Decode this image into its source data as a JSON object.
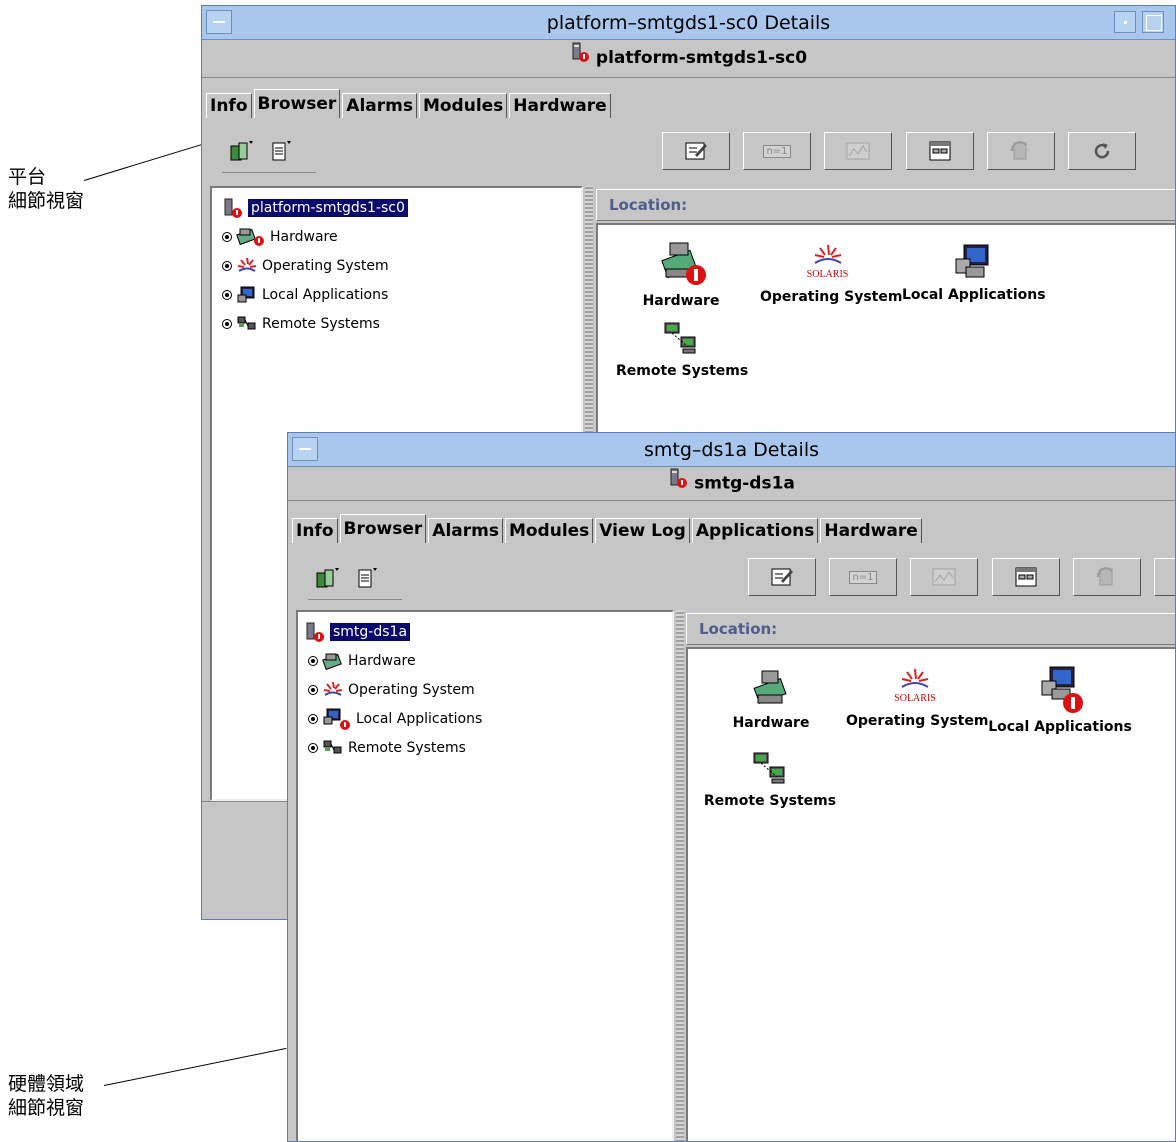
{
  "callouts": [
    {
      "line1": "平台",
      "line2": "細節視窗"
    },
    {
      "line1": "硬體領域",
      "line2": "細節視窗"
    }
  ],
  "window_platform": {
    "title": "platform–smtgds1-sc0 Details",
    "host": "platform-smtgds1-sc0",
    "tabs": [
      "Info",
      "Browser",
      "Alarms",
      "Modules",
      "Hardware"
    ],
    "active_tab": "Browser",
    "tree": {
      "root": "platform-smtgds1-sc0",
      "items": [
        "Hardware",
        "Operating System",
        "Local Applications",
        "Remote Systems"
      ]
    },
    "location_label": "Location:",
    "content_items": [
      "Hardware",
      "Operating System",
      "Local Applications",
      "Remote Systems"
    ],
    "solaris_text": "SOLARIS",
    "alarm_items": [
      "Hardware"
    ]
  },
  "window_domain": {
    "title": "smtg–ds1a Details",
    "host": "smtg-ds1a",
    "tabs": [
      "Info",
      "Browser",
      "Alarms",
      "Modules",
      "View Log",
      "Applications",
      "Hardware"
    ],
    "active_tab": "Browser",
    "tree": {
      "root": "smtg-ds1a",
      "items": [
        "Hardware",
        "Operating System",
        "Local Applications",
        "Remote Systems"
      ]
    },
    "location_label": "Location:",
    "content_items": [
      "Hardware",
      "Operating System",
      "Local Applications",
      "Remote Systems"
    ],
    "solaris_text": "SOLARIS",
    "alarm_items": [
      "Local Applications"
    ]
  },
  "toolbar_button_text": {
    "row_button": "n=1"
  },
  "colors": {
    "titlebar": "#a9c7ec",
    "window_bg": "#c6c6c6",
    "selection": "#0a0a6e",
    "alarm": "#dd1111",
    "location_text": "#4e5d8a"
  }
}
